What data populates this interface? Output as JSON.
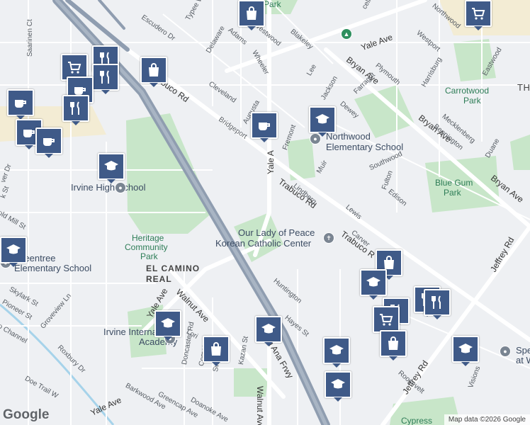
{
  "map": {
    "logo": "Google",
    "attribution": "Map data ©2026 Google",
    "colors": {
      "land": "#eef0f3",
      "park": "#c8e6c9",
      "road": "#ffffff",
      "freeway": "#8f9db0",
      "water": "#a6d3ea",
      "pin": "#3f5a88"
    },
    "labels": {
      "irvine_high": "Irvine High School",
      "heritage1": "Heritage",
      "heritage2": "Community",
      "heritage3": "Park",
      "greentree1": "Greentree",
      "greentree2": "Elementary School",
      "el_camino1": "EL CAMINO",
      "el_camino2": "REAL",
      "irvine_intl1": "Irvine International",
      "irvine_intl2": "Academy",
      "northwood1": "Northwood",
      "northwood2": "Elementary School",
      "carrotwood1": "Carrotwood",
      "carrotwood2": "Park",
      "bluegum1": "Blue Gum",
      "bluegum2": "Park",
      "olp1": "Our Lady of Peace",
      "olp2": "Korean Catholic Center",
      "cypress": "Cypress",
      "spec": "Spe",
      "spec2": "at W",
      "th": "TH",
      "park_top": "B",
      "park_top2": "Park"
    },
    "streets": {
      "trabuco_top": "Trabuco Rd",
      "trabuco_mid": "Trabuco Rd",
      "trabuco_low": "Trabuco R",
      "yale_ave_top": "Yale Ave",
      "yale_ave_v": "Yale A",
      "yale_ave_sw": "Yale Ave",
      "yale_ave_bottom": "Yale Ave",
      "bryan_ave": "Bryan Ave",
      "bryan_ave2": "Bryan Ave",
      "bryan_ave3": "Bryan Ave",
      "jeffrey_rd": "Jeffrey Rd",
      "jeffrey_rd2": "Jeffrey Rd",
      "walnut_ave": "Walnut Ave",
      "walnut_ave2": "Walnut Ave",
      "ana_frwy": "a Ana Frwy",
      "escudero": "Escudero Dr",
      "typee": "Typee Way",
      "delaware": "Delaware",
      "adams": "Adams",
      "westwood": "Westwood",
      "wheeler": "Wheeler",
      "blakeley": "Blakeley",
      "lee": "Lee",
      "jackson": "Jackson",
      "farragut": "Farragut",
      "plymouth": "Plymouth",
      "westport": "Westport",
      "harrisburg": "Harrisburg",
      "northwood": "Northwood",
      "eastwood": "Eastwood",
      "cleveland": "Cleveland",
      "augusta": "Augusta",
      "bridgeport": "Bridgeport",
      "fremont": "Fremont",
      "dewey": "Dewey",
      "mecklenberg": "Mecklenberg",
      "bennington": "Bennington",
      "duane": "Duane",
      "southwood": "Southwood",
      "muir": "Muir",
      "lindberg": "Lindberg",
      "fulton": "Fulton",
      "edison": "Edison",
      "lewis": "Lewis",
      "carver": "Carver",
      "huntington": "Huntington",
      "hayes": "Hayes St",
      "roosevelt": "Roosevelt",
      "visions": "Visions",
      "saarinen": "Saarinen Ct",
      "celio": "cello",
      "river_dr": "ver Dr",
      "k_st": "k St",
      "old_mill": "old Mill St",
      "skylark": "Skylark St",
      "pioneer": "Pioneer St",
      "groveview": "Groveview Ln",
      "channel": "o Channel",
      "roxbury": "Roxbury Dr",
      "doe_trail": "Doe Trail W",
      "barkwood": "Barkwood Ave",
      "doncaster": "Doncaster Rd",
      "greencap": "Greencap Ave",
      "doanoke": "Doanoke Ave",
      "comet": "Comet St",
      "sweetan": "Sweetan St",
      "kazan": "Kazan St",
      "lori": "Lori"
    },
    "icons": [
      "shopping-bag-icon",
      "cafe-icon",
      "restaurant-icon",
      "grocery-cart-icon",
      "school-icon",
      "shopping-bag-icon",
      "cafe-icon",
      "school-icon",
      "restaurant-icon",
      "grocery-cart-icon"
    ]
  }
}
